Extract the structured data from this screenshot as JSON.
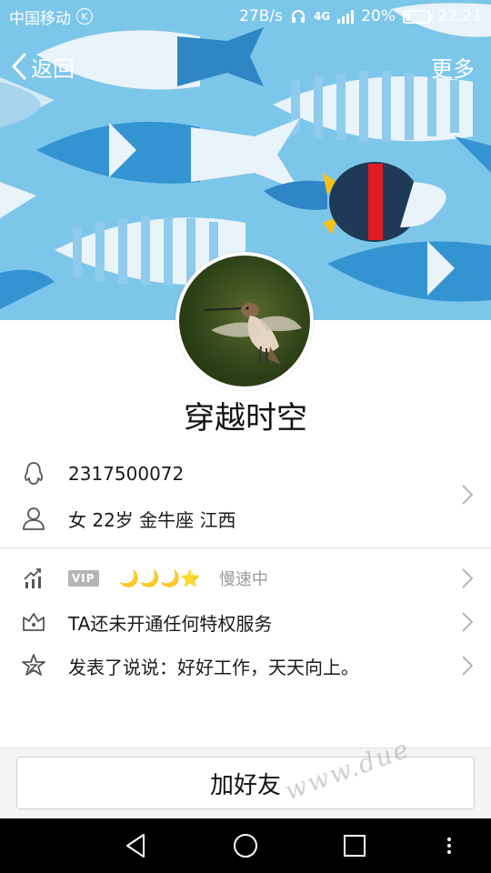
{
  "status_bar": {
    "carrier": "中国移动",
    "carrier_badge": "K",
    "net_speed": "27B/s",
    "network_type": "4G",
    "battery_percent": "20%",
    "battery_level": 0.2,
    "time": "22:21"
  },
  "nav": {
    "back_label": "返回",
    "more_label": "更多"
  },
  "profile": {
    "nickname": "穿越时空",
    "qq_number": "2317500072",
    "details": "女  22岁  金牛座  江西",
    "vip_tag": "VIP",
    "vip_level_icons": "🌙🌙🌙⭐",
    "vip_status": "慢速中",
    "privilege_text": "TA还未开通任何特权服务",
    "latest_post": "发表了说说：好好工作，天天向上。"
  },
  "actions": {
    "add_friend_label": "加好友"
  },
  "watermark": "www.due",
  "colors": {
    "banner_bg": "#7cc6ea",
    "fish_dark": "#2f86c4",
    "fish_light": "#e9f3fa",
    "icon_gray": "#555555"
  }
}
